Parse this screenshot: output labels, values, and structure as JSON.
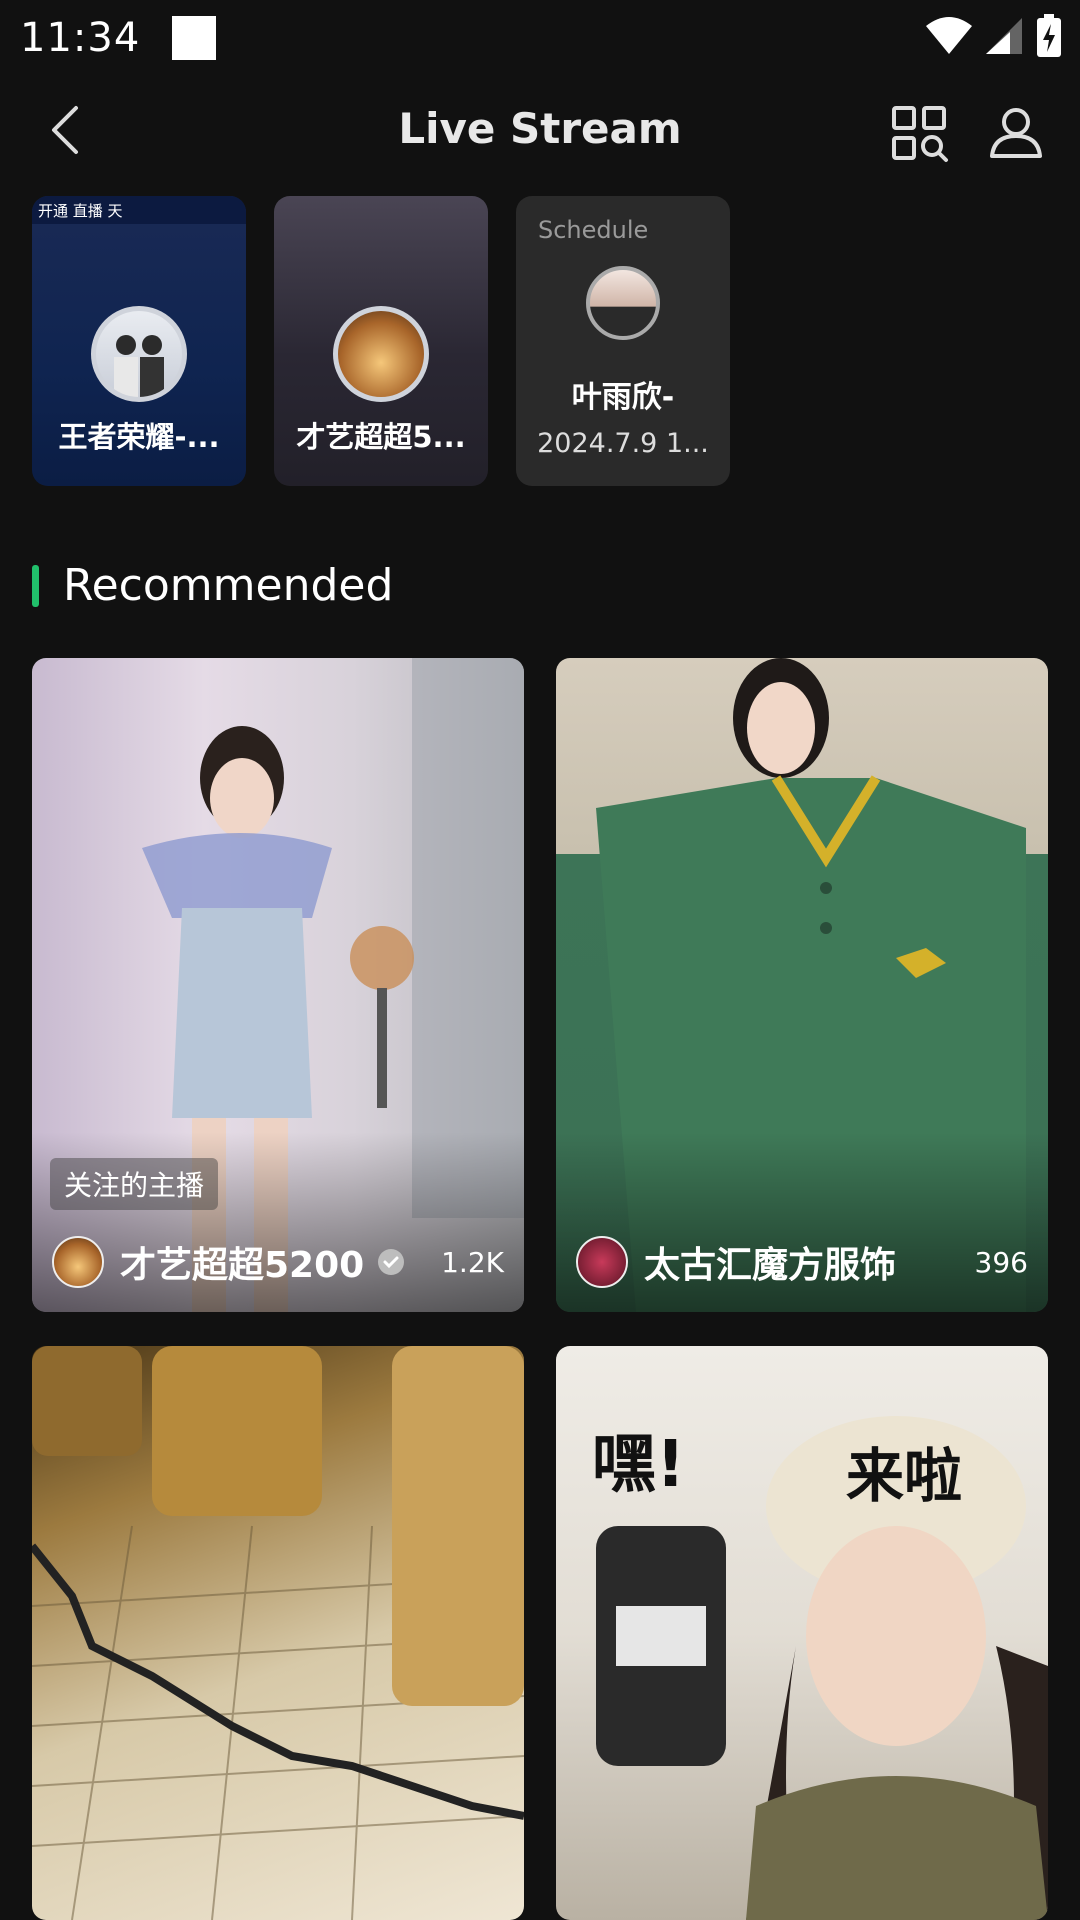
{
  "status_bar": {
    "time": "11:34"
  },
  "nav": {
    "title": "Live Stream"
  },
  "stories": [
    {
      "name": "王者荣耀-...",
      "banner": "开通 直播 天"
    },
    {
      "name": "才艺超超5..."
    }
  ],
  "schedule": {
    "label": "Schedule",
    "name": "叶雨欣-",
    "date": "2024.7.9 1..."
  },
  "section": {
    "title": "Recommended"
  },
  "cards": [
    {
      "tag": "关注的主播",
      "name": "才艺超超5200",
      "viewers": "1.2K",
      "verified": true
    },
    {
      "name": "太古汇魔方服饰",
      "viewers": "396"
    }
  ],
  "decor": {
    "card4_text_1": "嘿!",
    "card4_text_2": "来啦"
  },
  "colors": {
    "background": "#111111",
    "accent": "#21c06b"
  }
}
